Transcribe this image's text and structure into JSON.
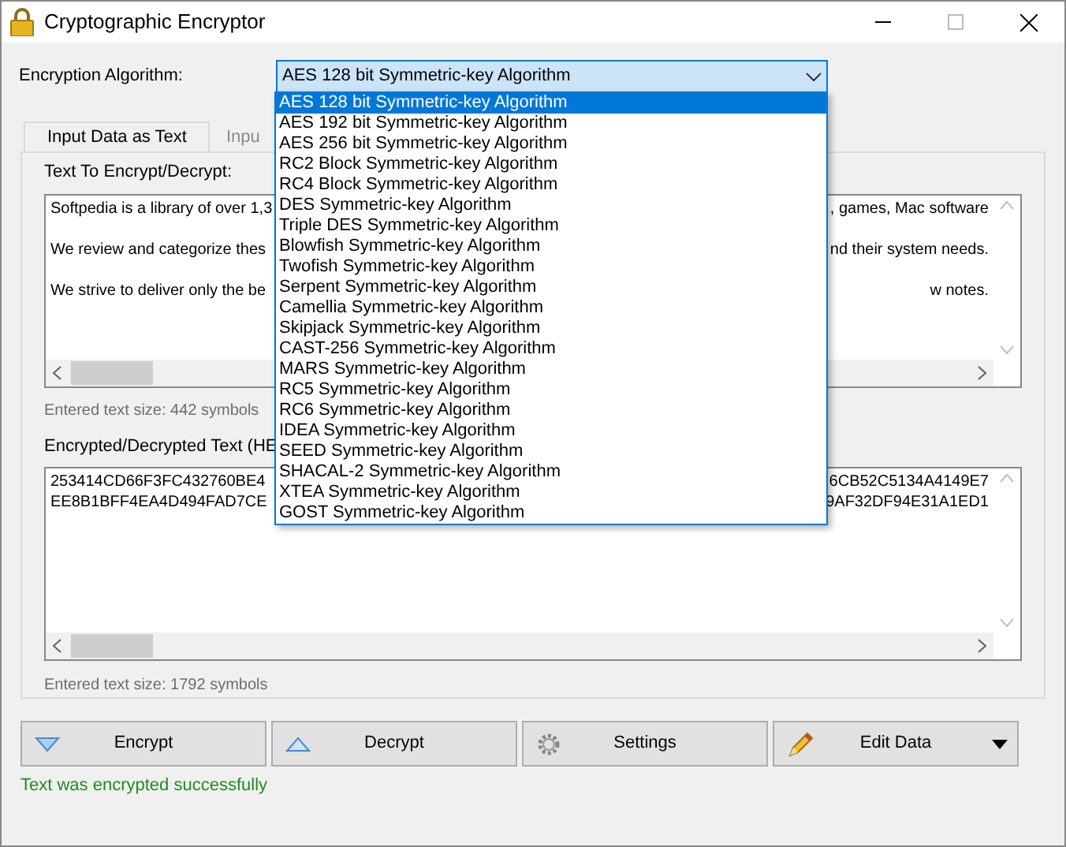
{
  "window": {
    "title": "Cryptographic Encryptor"
  },
  "algorithm": {
    "label": "Encryption Algorithm:",
    "value": "AES 128 bit Symmetric-key Algorithm",
    "expanded": true,
    "options": [
      {
        "label": "AES 128 bit Symmetric-key Algorithm",
        "selected": true
      },
      {
        "label": "AES 192 bit Symmetric-key Algorithm",
        "selected": false
      },
      {
        "label": "AES 256 bit Symmetric-key Algorithm",
        "selected": false
      },
      {
        "label": "RC2 Block Symmetric-key Algorithm",
        "selected": false
      },
      {
        "label": "RC4 Block Symmetric-key Algorithm",
        "selected": false
      },
      {
        "label": "DES Symmetric-key Algorithm",
        "selected": false
      },
      {
        "label": "Triple DES Symmetric-key Algorithm",
        "selected": false
      },
      {
        "label": "Blowfish Symmetric-key Algorithm",
        "selected": false
      },
      {
        "label": "Twofish Symmetric-key Algorithm",
        "selected": false
      },
      {
        "label": "Serpent Symmetric-key Algorithm",
        "selected": false
      },
      {
        "label": "Camellia Symmetric-key Algorithm",
        "selected": false
      },
      {
        "label": "Skipjack Symmetric-key Algorithm",
        "selected": false
      },
      {
        "label": "CAST-256 Symmetric-key Algorithm",
        "selected": false
      },
      {
        "label": "MARS Symmetric-key Algorithm",
        "selected": false
      },
      {
        "label": "RC5 Symmetric-key Algorithm",
        "selected": false
      },
      {
        "label": "RC6 Symmetric-key Algorithm",
        "selected": false
      },
      {
        "label": "IDEA Symmetric-key Algorithm",
        "selected": false
      },
      {
        "label": "SEED Symmetric-key Algorithm",
        "selected": false
      },
      {
        "label": "SHACAL-2 Symmetric-key Algorithm",
        "selected": false
      },
      {
        "label": "XTEA Symmetric-key Algorithm",
        "selected": false
      },
      {
        "label": "GOST Symmetric-key Algorithm",
        "selected": false
      }
    ]
  },
  "tabs": [
    {
      "label": "Input Data as Text",
      "selected": true
    },
    {
      "label": "Inpu",
      "selected": false
    }
  ],
  "input_section": {
    "label": "Text To Encrypt/Decrypt:",
    "lines": [
      {
        "left": "Softpedia is a library of over 1,3",
        "right": ", games, Mac software"
      },
      {
        "left": "We review and categorize thes",
        "right": "nd their system needs."
      },
      {
        "left": "We strive to deliver only the be",
        "right": "w notes."
      }
    ],
    "size_text": "Entered text size: 442 symbols"
  },
  "output_section": {
    "label": "Encrypted/Decrypted Text (HE",
    "lines": [
      {
        "left": "253414CD66F3FC432760BE4",
        "right": "6CB52C5134A4149E7"
      },
      {
        "left": "EE8B1BFF4EA4D494FAD7CE",
        "right": "9AF32DF94E31A1ED1"
      }
    ],
    "size_text": "Entered text size: 1792 symbols"
  },
  "buttons": [
    {
      "label": "Encrypt",
      "kind": "encrypt"
    },
    {
      "label": "Decrypt",
      "kind": "decrypt"
    },
    {
      "label": "Settings",
      "kind": "settings"
    },
    {
      "label": "Edit Data",
      "kind": "edit"
    }
  ],
  "status": "Text was encrypted successfully"
}
